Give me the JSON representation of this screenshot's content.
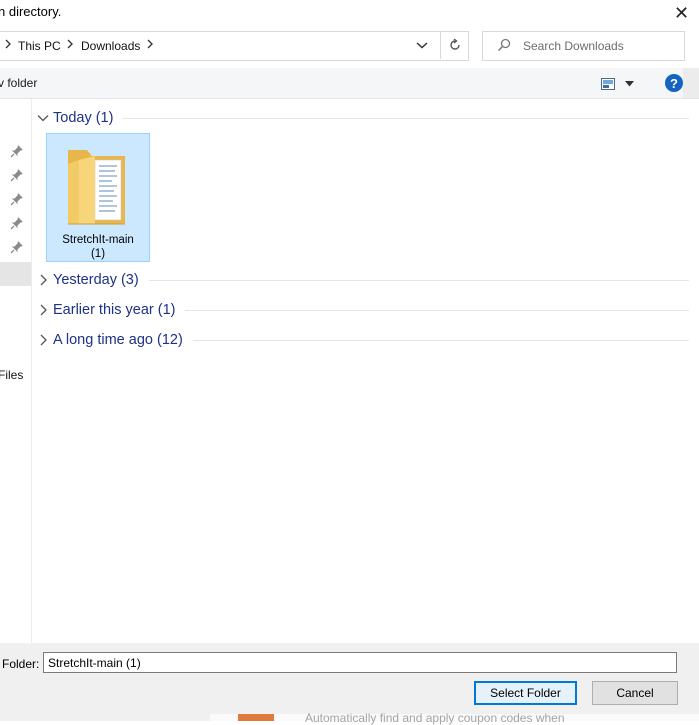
{
  "window": {
    "title_fragment": "n directory.",
    "close_glyph": "✕"
  },
  "address": {
    "crumbs": [
      "This PC",
      "Downloads"
    ],
    "separator": ">"
  },
  "search": {
    "placeholder": "Search Downloads",
    "icon": "search-icon"
  },
  "commandbar": {
    "new_folder_label": "v folder",
    "help_label": "?"
  },
  "nav": {
    "pins_count": 5,
    "files_label": "Files"
  },
  "groups": [
    {
      "label": "Today (1)",
      "expanded": true
    },
    {
      "label": "Yesterday (3)",
      "expanded": false
    },
    {
      "label": "Earlier this year (1)",
      "expanded": false
    },
    {
      "label": "A long time ago (12)",
      "expanded": false
    }
  ],
  "items": [
    {
      "name_line1": "StretchIt-main",
      "name_line2": "(1)",
      "selected": true
    }
  ],
  "footer": {
    "folder_label": "Folder:",
    "folder_value": "StretchIt-main (1)",
    "select_button": "Select Folder",
    "cancel_button": "Cancel"
  },
  "behind": {
    "text": "Automatically find and apply coupon codes when"
  },
  "colors": {
    "accent": "#0078d7",
    "group_title": "#1e3287",
    "selection_fill": "#cce8ff",
    "selection_border": "#99d1ff",
    "help_blue": "#1565c0"
  }
}
